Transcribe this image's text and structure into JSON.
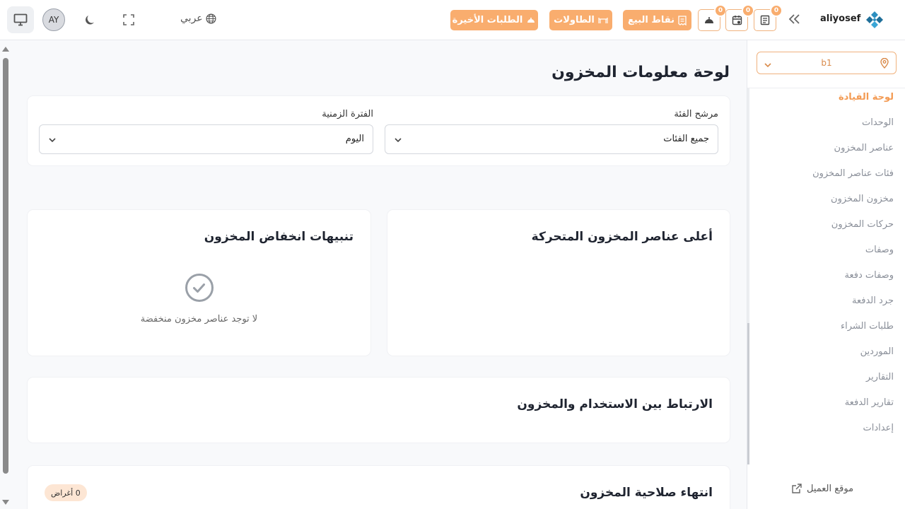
{
  "topbar": {
    "avatar_initials": "AY",
    "language_label": "عربي",
    "recent_orders_label": "الطلبات الأخيرة",
    "tables_label": "الطاولات",
    "pos_label": "نقاط البيع",
    "badges": [
      "0",
      "0",
      "0"
    ],
    "brand_name": "aliyosef"
  },
  "page": {
    "title": "لوحة معلومات المخزون",
    "filters": {
      "category_label": "مرشح الفئة",
      "category_value": "جميع الفئات",
      "period_label": "الفترة الزمنية",
      "period_value": "اليوم"
    },
    "cards": {
      "top_moving_title": "أعلى عناصر المخزون المتحركة",
      "low_stock_title": "تنبيهات انخفاض المخزون",
      "low_stock_empty": "لا توجد عناصر مخزون منخفضة",
      "correlation_title": "الارتباط بين الاستخدام والمخزون",
      "expiry_title": "انتهاء صلاحية المخزون",
      "expiry_count": "0 أغراض"
    }
  },
  "sidebar": {
    "branch": "b1",
    "items": [
      {
        "label": "لوحة القيادة",
        "active": true
      },
      {
        "label": "الوحدات",
        "active": false
      },
      {
        "label": "عناصر المخزون",
        "active": false
      },
      {
        "label": "فئات عناصر المخزون",
        "active": false
      },
      {
        "label": "مخزون المخزون",
        "active": false
      },
      {
        "label": "حركات المخزون",
        "active": false
      },
      {
        "label": "وصفات",
        "active": false
      },
      {
        "label": "وصفات دفعة",
        "active": false
      },
      {
        "label": "جرد الدفعة",
        "active": false
      },
      {
        "label": "طلبات الشراء",
        "active": false
      },
      {
        "label": "الموردين",
        "active": false
      },
      {
        "label": "التقارير",
        "active": false
      },
      {
        "label": "تقارير الدفعة",
        "active": false
      },
      {
        "label": "إعدادات",
        "active": false
      }
    ],
    "customer_site": "موقع العميل"
  },
  "colors": {
    "accent": "#f9ad6e",
    "active_nav": "#f39a52"
  }
}
